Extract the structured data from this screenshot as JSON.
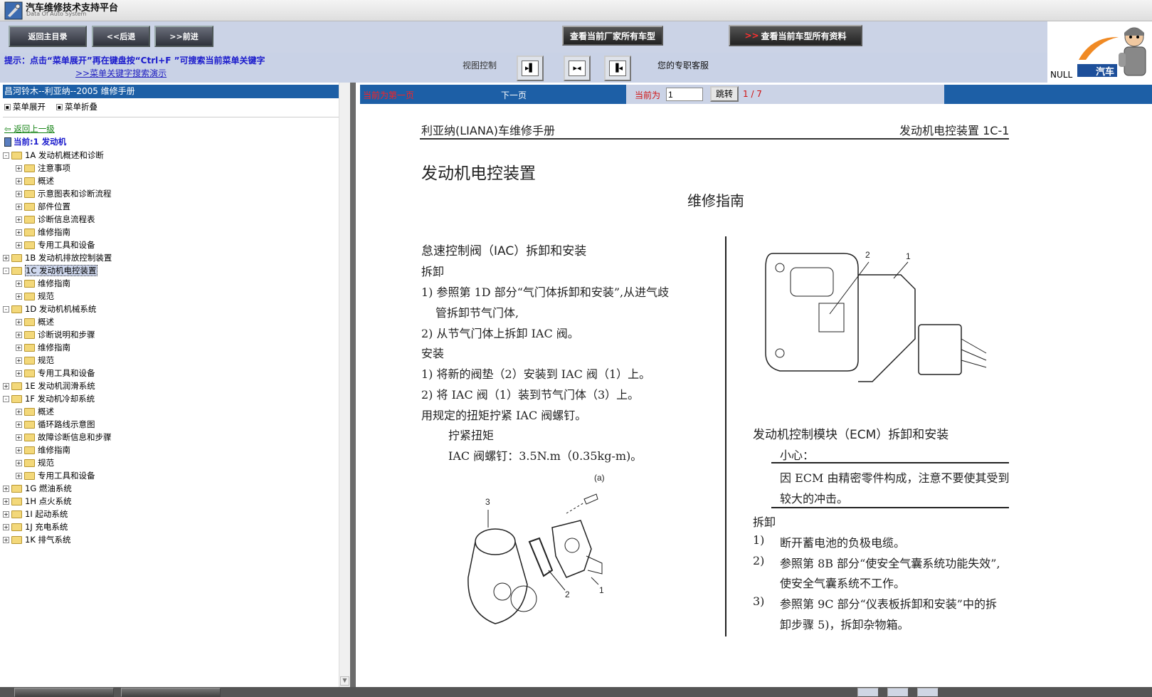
{
  "app": {
    "title": "汽车维修技术支持平台",
    "subtitle": "Data Of Auto System"
  },
  "toolbar": {
    "home": "返回主目录",
    "back": "<<后退",
    "forward": ">>前进",
    "all_models": "查看当前厂家所有车型",
    "all_data": "查看当前车型所有资料"
  },
  "hint": {
    "text": "提示：点击“菜单展开”再在键盘按“Ctrl+F ”可搜索当前菜单关键字",
    "link": ">>菜单关键字搜索演示"
  },
  "view": {
    "label": "视图控制",
    "service": "您的专职客服"
  },
  "logo": {
    "null_text": "NULL",
    "car_text": "汽车"
  },
  "left": {
    "header": "昌河铃木--利亚纳--2005 维修手册",
    "expand": "菜单展开",
    "collapse": "菜单折叠",
    "go_up": "返回上一级",
    "current": "当前:1 发动机"
  },
  "tree": [
    {
      "t": "1A 发动机概述和诊断",
      "l": 0,
      "pm": "-"
    },
    {
      "t": "注意事项",
      "l": 1,
      "pm": "+"
    },
    {
      "t": "概述",
      "l": 1,
      "pm": "+"
    },
    {
      "t": "示意图表和诊断流程",
      "l": 1,
      "pm": "+"
    },
    {
      "t": "部件位置",
      "l": 1,
      "pm": "+"
    },
    {
      "t": "诊断信息流程表",
      "l": 1,
      "pm": "+"
    },
    {
      "t": "维修指南",
      "l": 1,
      "pm": "+"
    },
    {
      "t": "专用工具和设备",
      "l": 1,
      "pm": "+"
    },
    {
      "t": "1B 发动机排放控制装置",
      "l": 0,
      "pm": "+"
    },
    {
      "t": "1C 发动机电控装置",
      "l": 0,
      "pm": "-",
      "sel": true
    },
    {
      "t": "维修指南",
      "l": 1,
      "pm": "+"
    },
    {
      "t": "规范",
      "l": 1,
      "pm": "+"
    },
    {
      "t": "1D 发动机机械系统",
      "l": 0,
      "pm": "-"
    },
    {
      "t": "概述",
      "l": 1,
      "pm": "+"
    },
    {
      "t": "诊断说明和步骤",
      "l": 1,
      "pm": "+"
    },
    {
      "t": "维修指南",
      "l": 1,
      "pm": "+"
    },
    {
      "t": "规范",
      "l": 1,
      "pm": "+"
    },
    {
      "t": "专用工具和设备",
      "l": 1,
      "pm": "+"
    },
    {
      "t": "1E 发动机润滑系统",
      "l": 0,
      "pm": "+"
    },
    {
      "t": "1F 发动机冷却系统",
      "l": 0,
      "pm": "-"
    },
    {
      "t": "概述",
      "l": 1,
      "pm": "+"
    },
    {
      "t": "循环路线示意图",
      "l": 1,
      "pm": "+"
    },
    {
      "t": "故障诊断信息和步骤",
      "l": 1,
      "pm": "+"
    },
    {
      "t": "维修指南",
      "l": 1,
      "pm": "+"
    },
    {
      "t": "规范",
      "l": 1,
      "pm": "+"
    },
    {
      "t": "专用工具和设备",
      "l": 1,
      "pm": "+"
    },
    {
      "t": "1G 燃油系统",
      "l": 0,
      "pm": "+"
    },
    {
      "t": "1H 点火系统",
      "l": 0,
      "pm": "+"
    },
    {
      "t": "1I 起动系统",
      "l": 0,
      "pm": "+"
    },
    {
      "t": "1J 充电系统",
      "l": 0,
      "pm": "+"
    },
    {
      "t": "1K 排气系统",
      "l": 0,
      "pm": "+"
    }
  ],
  "pager": {
    "first": "当前为第一页",
    "next": "下一页",
    "current_label": "当前为",
    "page_value": "1",
    "jump": "跳转",
    "count": "1 / 7"
  },
  "doc": {
    "header_left": "利亚纳(LIANA)车维修手册",
    "header_right": "发动机电控装置 1C-1",
    "title": "发动机电控装置",
    "subtitle": "维修指南",
    "iac_title": "怠速控制阀（IAC）拆卸和安装",
    "removal": "拆卸",
    "r1a": "1) 参照第 1D 部分“气门体拆卸和安装”,从进气歧",
    "r1b": "管拆卸节气门体,",
    "r2": "2) 从节气门体上拆卸 IAC 阀。",
    "install": "安装",
    "i1": "1) 将新的阀垫（2）安装到 IAC 阀（1）上。",
    "i2": "2) 将 IAC 阀（1）装到节气门体（3）上。",
    "i3": "用规定的扭矩拧紧 IAC 阀螺钉。",
    "torque_label": "拧紧扭矩",
    "torque_value": "IAC 阀螺钉：3.5N.m（0.35kg-m)。",
    "fig1": {
      "n1": "1",
      "n2": "2",
      "n3": "3",
      "na": "(a)"
    },
    "fig2": {
      "n1": "1",
      "n2": "2"
    },
    "ecm_title": "发动机控制模块（ECM）拆卸和安装",
    "caution": "小心：",
    "caution_a": "因 ECM 由精密零件构成，注意不要使其受到",
    "caution_b": "较大的冲击。",
    "removal2": "拆卸",
    "e1n": "1)",
    "e1": "断开蓄电池的负极电缆。",
    "e2n": "2)",
    "e2a": "参照第 8B 部分“使安全气囊系统功能失效”,",
    "e2b": "使安全气囊系统不工作。",
    "e3n": "3)",
    "e3a": "参照第 9C 部分“仪表板拆卸和安装”中的拆",
    "e3b": "卸步骤 5)，拆卸杂物箱。"
  }
}
